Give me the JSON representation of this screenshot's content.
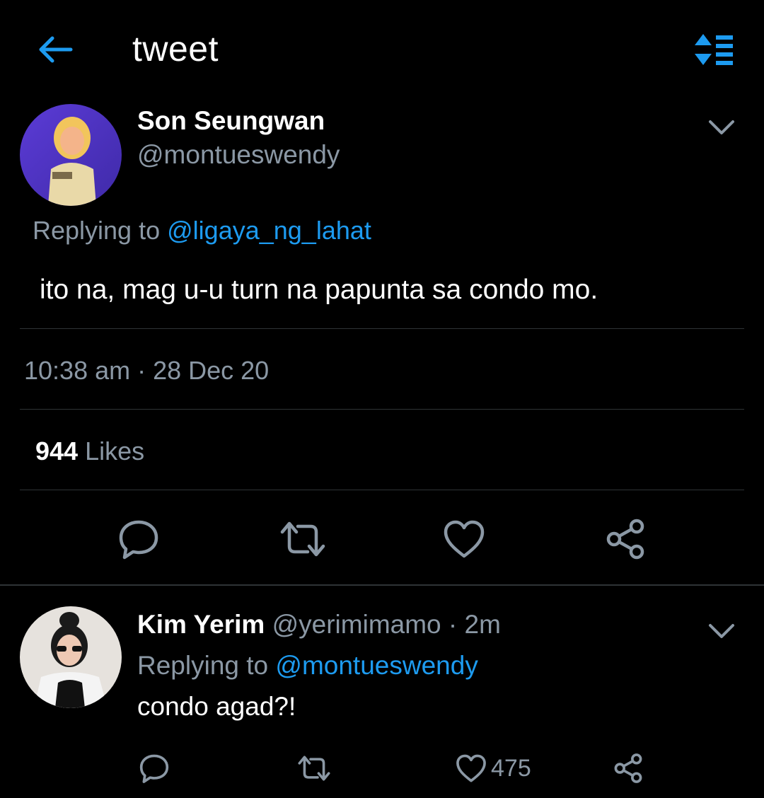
{
  "header": {
    "title": "tweet",
    "back_icon": "arrow-left-icon",
    "sort_icon": "sort-replies-icon"
  },
  "tweet": {
    "author_name": "Son Seungwan",
    "author_handle": "@montueswendy",
    "replying_prefix": "Replying to",
    "replying_to": "@ligaya_ng_lahat",
    "text": "ito na, mag u-u turn na papunta sa condo mo.",
    "timestamp": "10:38 am · 28 Dec 20",
    "likes_count": "944",
    "likes_label": "Likes"
  },
  "reply": {
    "author_name": "Kim Yerim",
    "author_handle": "@yerimimamo",
    "time": "· 2m",
    "replying_prefix": "Replying to",
    "replying_to": "@montueswendy",
    "text": "condo agad?!",
    "like_count": "475"
  },
  "colors": {
    "background": "#000000",
    "accent": "#1d9bf0",
    "muted": "#8b98a5",
    "divider": "#2f3336"
  }
}
